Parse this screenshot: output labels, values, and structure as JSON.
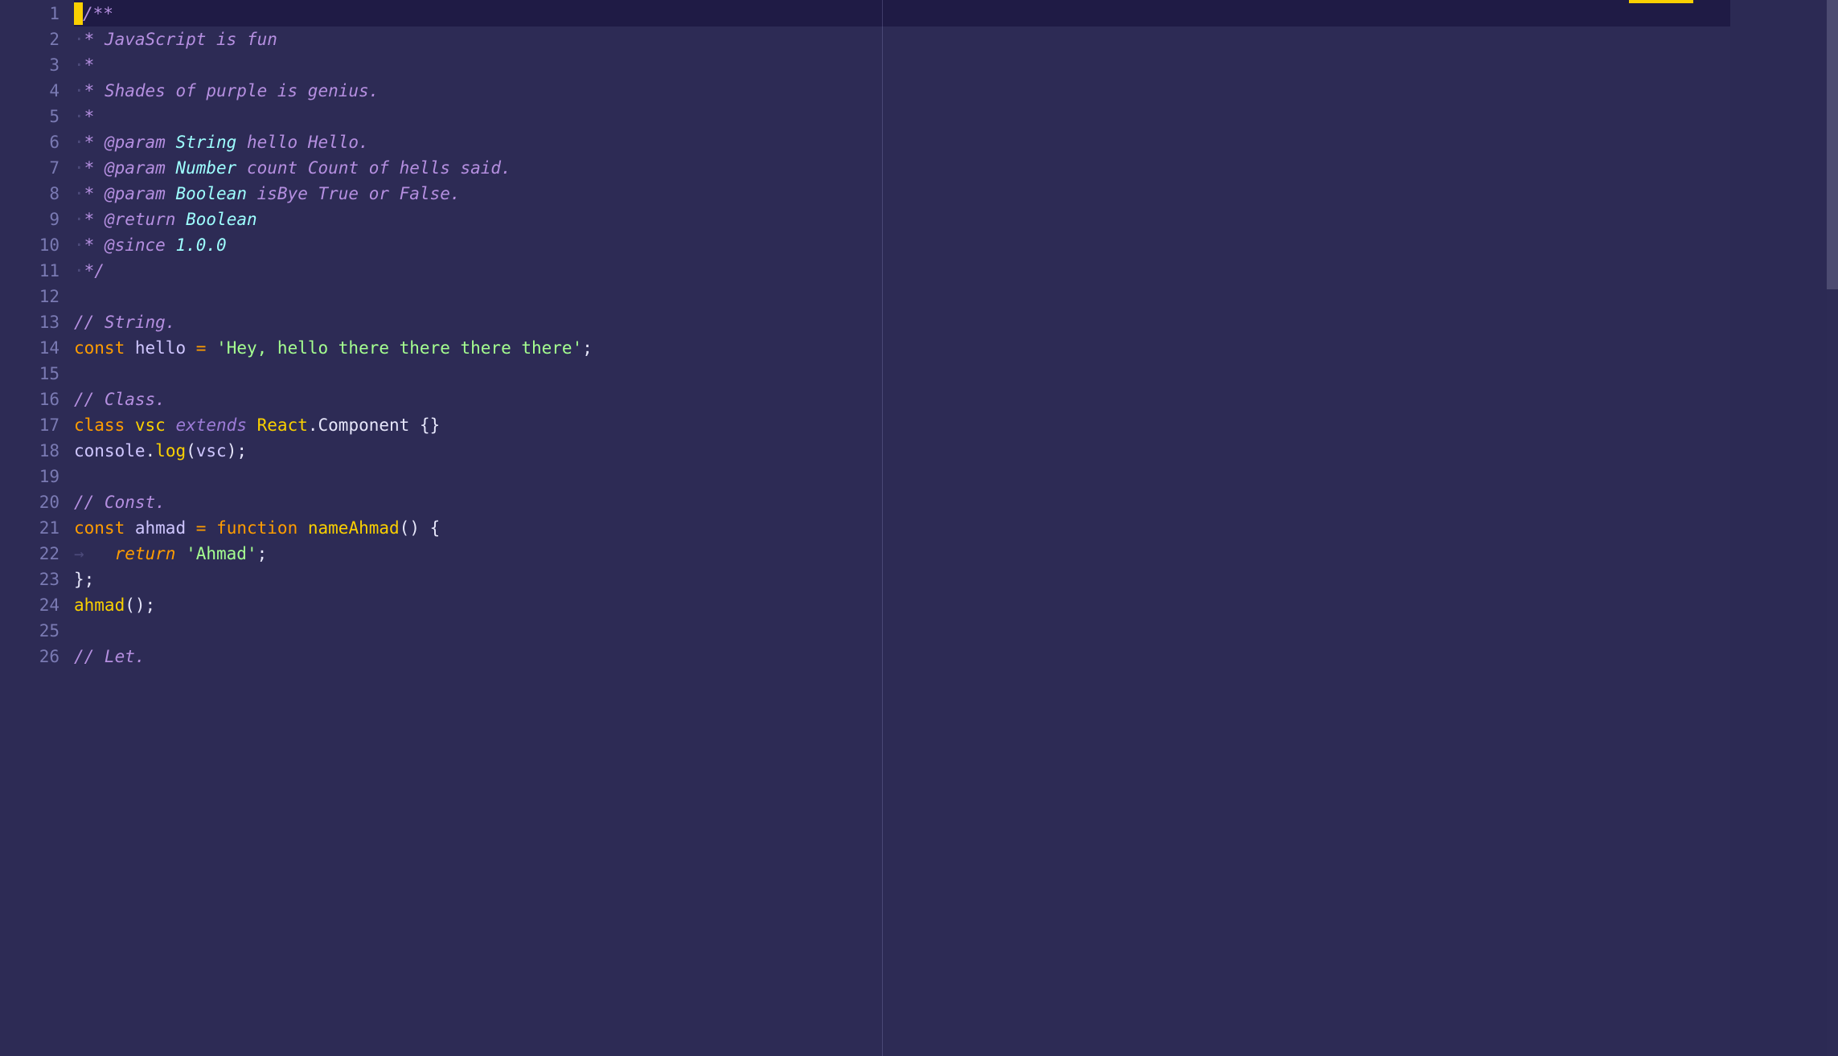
{
  "colors": {
    "background": "#2d2b55",
    "gutter": "#7a7ab3",
    "comment": "#b58fe0",
    "type": "#9effff",
    "keyword": "#ff9d00",
    "name": "#fad000",
    "string": "#a5ff90",
    "text": "#e6e6fa",
    "whitespace": "#4c4a7a",
    "cursor": "#fad000"
  },
  "lines": {
    "total": 26,
    "rows": [
      {
        "n": 1,
        "tokens": [
          {
            "cursor": true
          },
          {
            "cls": "c-comment",
            "t": "/**"
          }
        ]
      },
      {
        "n": 2,
        "tokens": [
          {
            "cls": "c-faint",
            "t": "·"
          },
          {
            "cls": "c-comment",
            "t": "* JavaScript is fun"
          }
        ]
      },
      {
        "n": 3,
        "tokens": [
          {
            "cls": "c-faint",
            "t": "·"
          },
          {
            "cls": "c-comment",
            "t": "*"
          }
        ]
      },
      {
        "n": 4,
        "tokens": [
          {
            "cls": "c-faint",
            "t": "·"
          },
          {
            "cls": "c-comment",
            "t": "* Shades of purple is genius."
          }
        ]
      },
      {
        "n": 5,
        "tokens": [
          {
            "cls": "c-faint",
            "t": "·"
          },
          {
            "cls": "c-comment",
            "t": "*"
          }
        ]
      },
      {
        "n": 6,
        "tokens": [
          {
            "cls": "c-faint",
            "t": "·"
          },
          {
            "cls": "c-comment",
            "t": "* "
          },
          {
            "cls": "c-tag",
            "t": "@param"
          },
          {
            "cls": "c-comment",
            "t": " "
          },
          {
            "cls": "c-type",
            "t": "String"
          },
          {
            "cls": "c-comment",
            "t": " "
          },
          {
            "cls": "c-docvar",
            "t": "hello"
          },
          {
            "cls": "c-comment",
            "t": " Hello."
          }
        ]
      },
      {
        "n": 7,
        "tokens": [
          {
            "cls": "c-faint",
            "t": "·"
          },
          {
            "cls": "c-comment",
            "t": "* "
          },
          {
            "cls": "c-tag",
            "t": "@param"
          },
          {
            "cls": "c-comment",
            "t": " "
          },
          {
            "cls": "c-type",
            "t": "Number"
          },
          {
            "cls": "c-comment",
            "t": " "
          },
          {
            "cls": "c-docvar",
            "t": "count"
          },
          {
            "cls": "c-comment",
            "t": " Count of hells said."
          }
        ]
      },
      {
        "n": 8,
        "tokens": [
          {
            "cls": "c-faint",
            "t": "·"
          },
          {
            "cls": "c-comment",
            "t": "* "
          },
          {
            "cls": "c-tag",
            "t": "@param"
          },
          {
            "cls": "c-comment",
            "t": " "
          },
          {
            "cls": "c-type",
            "t": "Boolean"
          },
          {
            "cls": "c-comment",
            "t": " "
          },
          {
            "cls": "c-docvar",
            "t": "isBye"
          },
          {
            "cls": "c-comment",
            "t": " True or False."
          }
        ]
      },
      {
        "n": 9,
        "tokens": [
          {
            "cls": "c-faint",
            "t": "·"
          },
          {
            "cls": "c-comment",
            "t": "* "
          },
          {
            "cls": "c-tag",
            "t": "@return"
          },
          {
            "cls": "c-comment",
            "t": " "
          },
          {
            "cls": "c-type",
            "t": "Boolean"
          }
        ]
      },
      {
        "n": 10,
        "tokens": [
          {
            "cls": "c-faint",
            "t": "·"
          },
          {
            "cls": "c-comment",
            "t": "* "
          },
          {
            "cls": "c-tag",
            "t": "@since"
          },
          {
            "cls": "c-comment",
            "t": " "
          },
          {
            "cls": "c-ver",
            "t": "1.0.0"
          }
        ]
      },
      {
        "n": 11,
        "tokens": [
          {
            "cls": "c-faint",
            "t": "·"
          },
          {
            "cls": "c-comment",
            "t": "*/"
          }
        ]
      },
      {
        "n": 12,
        "tokens": []
      },
      {
        "n": 13,
        "tokens": [
          {
            "cls": "c-comment",
            "t": "// String."
          }
        ]
      },
      {
        "n": 14,
        "tokens": [
          {
            "cls": "c-keyword",
            "t": "const"
          },
          {
            "cls": "c-white",
            "t": " "
          },
          {
            "cls": "c-lav",
            "t": "hello"
          },
          {
            "cls": "c-white",
            "t": " "
          },
          {
            "cls": "c-op",
            "t": "="
          },
          {
            "cls": "c-white",
            "t": " "
          },
          {
            "cls": "c-string",
            "t": "'Hey, hello there there there there'"
          },
          {
            "cls": "c-white",
            "t": ";"
          }
        ]
      },
      {
        "n": 15,
        "tokens": []
      },
      {
        "n": 16,
        "tokens": [
          {
            "cls": "c-comment",
            "t": "// Class."
          }
        ]
      },
      {
        "n": 17,
        "tokens": [
          {
            "cls": "c-keyword",
            "t": "class"
          },
          {
            "cls": "c-white",
            "t": " "
          },
          {
            "cls": "c-class",
            "t": "vsc"
          },
          {
            "cls": "c-white",
            "t": " "
          },
          {
            "cls": "c-extends",
            "t": "extends"
          },
          {
            "cls": "c-white",
            "t": " "
          },
          {
            "cls": "c-class",
            "t": "React"
          },
          {
            "cls": "c-white",
            "t": "."
          },
          {
            "cls": "c-white",
            "t": "Component"
          },
          {
            "cls": "c-white",
            "t": " {}"
          }
        ]
      },
      {
        "n": 18,
        "tokens": [
          {
            "cls": "c-lav",
            "t": "console"
          },
          {
            "cls": "c-white",
            "t": "."
          },
          {
            "cls": "c-fn",
            "t": "log"
          },
          {
            "cls": "c-white",
            "t": "("
          },
          {
            "cls": "c-lav",
            "t": "vsc"
          },
          {
            "cls": "c-white",
            "t": ");"
          }
        ]
      },
      {
        "n": 19,
        "tokens": []
      },
      {
        "n": 20,
        "tokens": [
          {
            "cls": "c-comment",
            "t": "// Const."
          }
        ]
      },
      {
        "n": 21,
        "tokens": [
          {
            "cls": "c-keyword",
            "t": "const"
          },
          {
            "cls": "c-white",
            "t": " "
          },
          {
            "cls": "c-lav",
            "t": "ahmad"
          },
          {
            "cls": "c-white",
            "t": " "
          },
          {
            "cls": "c-op",
            "t": "="
          },
          {
            "cls": "c-white",
            "t": " "
          },
          {
            "cls": "c-keyword",
            "t": "function"
          },
          {
            "cls": "c-white",
            "t": " "
          },
          {
            "cls": "c-fn",
            "t": "nameAhmad"
          },
          {
            "cls": "c-white",
            "t": "() {"
          }
        ]
      },
      {
        "n": 22,
        "tokens": [
          {
            "cls": "c-faint",
            "t": "→   "
          },
          {
            "cls": "c-keyword-i",
            "t": "return"
          },
          {
            "cls": "c-white",
            "t": " "
          },
          {
            "cls": "c-string",
            "t": "'Ahmad'"
          },
          {
            "cls": "c-white",
            "t": ";"
          }
        ]
      },
      {
        "n": 23,
        "tokens": [
          {
            "cls": "c-white",
            "t": "};"
          }
        ]
      },
      {
        "n": 24,
        "tokens": [
          {
            "cls": "c-fn",
            "t": "ahmad"
          },
          {
            "cls": "c-white",
            "t": "();"
          }
        ]
      },
      {
        "n": 25,
        "tokens": []
      },
      {
        "n": 26,
        "tokens": [
          {
            "cls": "c-comment",
            "t": "// Let."
          }
        ]
      }
    ]
  }
}
